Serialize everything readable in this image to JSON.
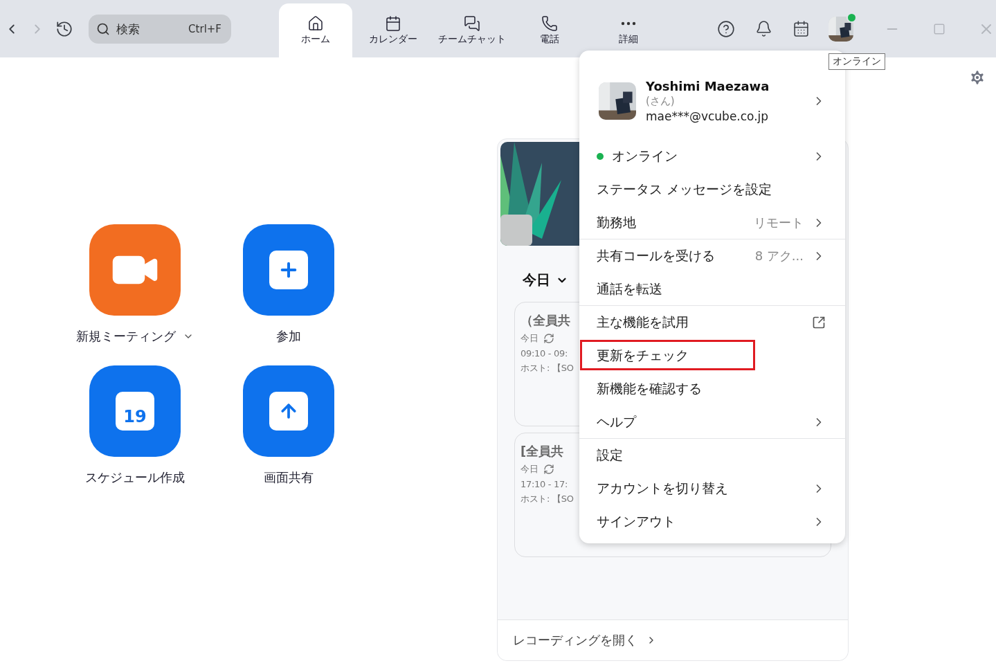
{
  "nav": {
    "forward_disabled": true
  },
  "search": {
    "placeholder": "検索",
    "shortcut": "Ctrl+F"
  },
  "tabs": [
    {
      "label": "ホーム",
      "selected": true
    },
    {
      "label": "カレンダー",
      "selected": false
    },
    {
      "label": "チームチャット",
      "selected": false
    },
    {
      "label": "電話",
      "selected": false
    },
    {
      "label": "詳細",
      "selected": false
    }
  ],
  "presence": {
    "tooltip": "オンライン"
  },
  "tiles": [
    {
      "label": "新規ミーティング",
      "kind": "video",
      "color": "#f26d21",
      "dropdown": true
    },
    {
      "label": "参加",
      "kind": "plus",
      "color": "#0e72ed",
      "dropdown": false
    },
    {
      "label": "スケジュール作成",
      "kind": "calendar",
      "color": "#0e72ed",
      "dropdown": false,
      "day": "19"
    },
    {
      "label": "画面共有",
      "kind": "share",
      "color": "#0e72ed",
      "dropdown": false
    }
  ],
  "meetings": {
    "day_label": "今日",
    "cards": [
      {
        "title": "（全員共",
        "day": "今日",
        "time": "09:10 - 09:",
        "host": "ホスト: 【SO"
      },
      {
        "title": "[全員共",
        "day": "今日",
        "time": "17:10 - 17:",
        "host": "ホスト: 【SO"
      }
    ],
    "footer_link": "レコーディングを開く"
  },
  "menu": {
    "user": {
      "name": "Yoshimi Maezawa",
      "honorific": "(さん)",
      "email": "mae***@vcube.co.jp"
    },
    "items": [
      {
        "kind": "status",
        "label": "オンライン",
        "chevron": true,
        "divider_before": false,
        "highlighted": false
      },
      {
        "kind": "item",
        "label": "ステータス メッセージを設定",
        "chevron": false,
        "divider_before": false,
        "highlighted": false
      },
      {
        "kind": "item",
        "label": "勤務地",
        "value": "リモート",
        "chevron": true,
        "divider_before": false,
        "highlighted": false
      },
      {
        "kind": "item",
        "label": "共有コールを受ける",
        "value": "8 アク...",
        "chevron": true,
        "divider_before": true,
        "highlighted": false
      },
      {
        "kind": "item",
        "label": "通話を転送",
        "chevron": false,
        "divider_before": false,
        "highlighted": false
      },
      {
        "kind": "external",
        "label": "主な機能を試用",
        "chevron": false,
        "divider_before": true,
        "highlighted": false
      },
      {
        "kind": "item",
        "label": "更新をチェック",
        "chevron": false,
        "divider_before": false,
        "highlighted": true
      },
      {
        "kind": "item",
        "label": "新機能を確認する",
        "chevron": false,
        "divider_before": false,
        "highlighted": false
      },
      {
        "kind": "item",
        "label": "ヘルプ",
        "chevron": true,
        "divider_before": false,
        "highlighted": false
      },
      {
        "kind": "item",
        "label": "設定",
        "chevron": false,
        "divider_before": true,
        "highlighted": false
      },
      {
        "kind": "item",
        "label": "アカウントを切り替え",
        "chevron": true,
        "divider_before": false,
        "highlighted": false
      },
      {
        "kind": "item",
        "label": "サインアウト",
        "chevron": true,
        "divider_before": false,
        "highlighted": false
      }
    ]
  }
}
